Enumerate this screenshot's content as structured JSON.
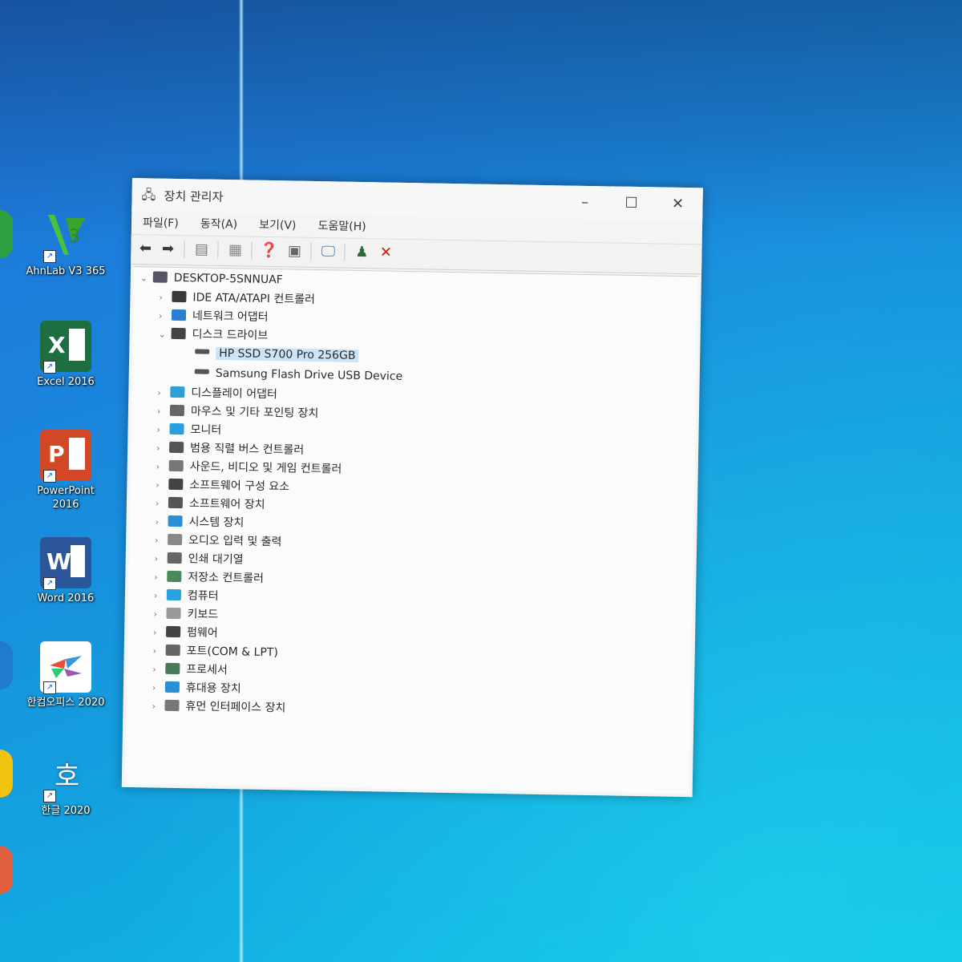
{
  "desktop": {
    "icons": [
      {
        "label": "AhnLab V3 365",
        "name": "ahnlab-v3-icon"
      },
      {
        "label": "Excel 2016",
        "name": "excel-icon"
      },
      {
        "label": "PowerPoint 2016",
        "name": "powerpoint-icon"
      },
      {
        "label": "Word 2016",
        "name": "word-icon"
      },
      {
        "label": "한컴오피스 2020",
        "name": "hancom-office-icon"
      },
      {
        "label": "한글 2020",
        "name": "hangul-icon"
      }
    ]
  },
  "window": {
    "title": "장치 관리자",
    "minimize": "–",
    "maximize": "☐",
    "close": "✕",
    "menu": [
      "파일(F)",
      "동작(A)",
      "보기(V)",
      "도움말(H)"
    ],
    "root": "DESKTOP-5SNNUAF",
    "tree": [
      {
        "label": "IDE ATA/ATAPI 컨트롤러",
        "expanded": false,
        "color": "#3a3a3a"
      },
      {
        "label": "네트워크 어댑터",
        "expanded": false,
        "color": "#2a7fd4"
      },
      {
        "label": "디스크 드라이브",
        "expanded": true,
        "color": "#444444",
        "children": [
          "HP SSD S700 Pro 256GB",
          "Samsung Flash Drive USB Device"
        ]
      },
      {
        "label": "디스플레이 어댑터",
        "expanded": false,
        "color": "#2aa1d4"
      },
      {
        "label": "마우스 및 기타 포인팅 장치",
        "expanded": false,
        "color": "#666666"
      },
      {
        "label": "모니터",
        "expanded": false,
        "color": "#2a9fe0"
      },
      {
        "label": "범용 직렬 버스 컨트롤러",
        "expanded": false,
        "color": "#555555"
      },
      {
        "label": "사운드, 비디오 및 게임 컨트롤러",
        "expanded": false,
        "color": "#777777"
      },
      {
        "label": "소프트웨어 구성 요소",
        "expanded": false,
        "color": "#444444"
      },
      {
        "label": "소프트웨어 장치",
        "expanded": false,
        "color": "#555555"
      },
      {
        "label": "시스템 장치",
        "expanded": false,
        "color": "#2a8fd4"
      },
      {
        "label": "오디오 입력 및 출력",
        "expanded": false,
        "color": "#888888"
      },
      {
        "label": "인쇄 대기열",
        "expanded": false,
        "color": "#666666"
      },
      {
        "label": "저장소 컨트롤러",
        "expanded": false,
        "color": "#4a8a5a"
      },
      {
        "label": "컴퓨터",
        "expanded": false,
        "color": "#2aa1e0"
      },
      {
        "label": "키보드",
        "expanded": false,
        "color": "#999999"
      },
      {
        "label": "펌웨어",
        "expanded": false,
        "color": "#444444"
      },
      {
        "label": "포트(COM & LPT)",
        "expanded": false,
        "color": "#666666"
      },
      {
        "label": "프로세서",
        "expanded": false,
        "color": "#4a7a5a"
      },
      {
        "label": "휴대용 장치",
        "expanded": false,
        "color": "#2a8fd4"
      },
      {
        "label": "휴먼 인터페이스 장치",
        "expanded": false,
        "color": "#777777"
      }
    ]
  }
}
